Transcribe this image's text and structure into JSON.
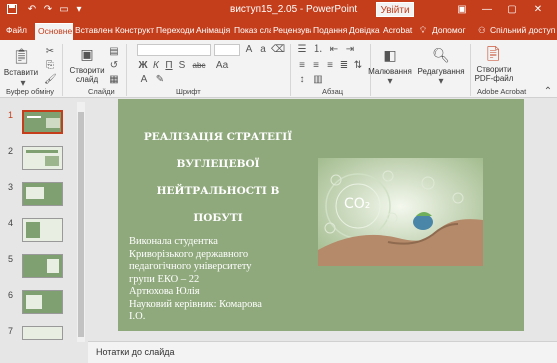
{
  "titlebar": {
    "title": "виступ15_2.05  -  PowerPoint",
    "signin_label": "Увійти"
  },
  "tabs": [
    {
      "label": "Файл"
    },
    {
      "label": "Основне"
    },
    {
      "label": "Вставлення"
    },
    {
      "label": "Конструкт"
    },
    {
      "label": "Переходи"
    },
    {
      "label": "Анімація"
    },
    {
      "label": "Показ слай"
    },
    {
      "label": "Рецензува"
    },
    {
      "label": "Подання"
    },
    {
      "label": "Довідка"
    },
    {
      "label": "Acrobat"
    },
    {
      "label": "Допомог"
    },
    {
      "label": "Спільний доступ"
    }
  ],
  "ribbon": {
    "paste_label": "Вставити",
    "new_slide_label": "Створити слайд",
    "draw_label": "Малювання",
    "edit_label": "Редагування",
    "pdf_label": "Створити PDF-файл",
    "groups": {
      "clipboard": "Буфер обміну",
      "slides": "Слайди",
      "font": "Шрифт",
      "paragraph": "Абзац",
      "acrobat": "Adobe Acrobat"
    },
    "font_buttons": [
      "Ж",
      "К",
      "П",
      "S",
      "abc",
      "Аа"
    ]
  },
  "thumbnails": [
    {
      "number": "1",
      "selected": true
    },
    {
      "number": "2",
      "selected": false
    },
    {
      "number": "3",
      "selected": false
    },
    {
      "number": "4",
      "selected": false
    },
    {
      "number": "5",
      "selected": false
    },
    {
      "number": "6",
      "selected": false
    },
    {
      "number": "7",
      "selected": false
    }
  ],
  "slide": {
    "title_lines": [
      "РЕАЛІЗАЦІЯ СТРАТЕГІЇ",
      "ВУГЛЕЦЕВОЇ",
      "НЕЙТРАЛЬНОСТІ В",
      "ПОБУТІ"
    ],
    "body_lines": [
      "Виконала студентка",
      "Криворізького державного",
      "педагогічного університету",
      "групи ЕКО – 22",
      "Артюхова Юлія",
      "Науковий керівник: Комарова",
      "І.О."
    ],
    "image_label": "CO₂"
  },
  "notes": {
    "label": "Нотатки до слайда"
  },
  "colors": {
    "accent": "#c43e1c",
    "slide_bg": "#8fa97c"
  }
}
